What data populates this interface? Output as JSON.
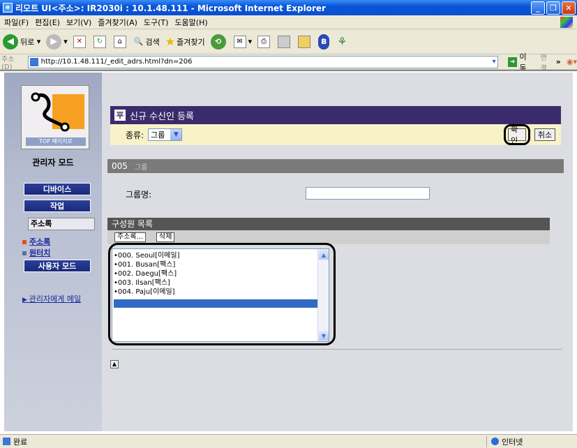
{
  "window": {
    "title": "리모트 UI<주소>: IR2030i : 10.1.48.111 - Microsoft Internet Explorer"
  },
  "menu": [
    "파일(F)",
    "편집(E)",
    "보기(V)",
    "즐겨찾기(A)",
    "도구(T)",
    "도움말(H)"
  ],
  "toolbar": {
    "back": "뒤로",
    "search": "검색",
    "favorites": "즐겨찾기"
  },
  "address": {
    "label": "주소(D)",
    "url": "http://10.1.48.111/_edit_adrs.html?dn=206",
    "go": "이동",
    "links": "연결"
  },
  "sidebar": {
    "top_label": "TOP 페이지로",
    "mode_title": "관리자 모드",
    "device": "디바이스",
    "job": "작업",
    "address_book": "주소록",
    "sub_address_book": "주소록",
    "sub_one_touch": "원터치",
    "user_mode": "사용자 모드",
    "mail_admin": "관리자에게 메일"
  },
  "form": {
    "title": "신규 수신인 등록",
    "type_label": "종류:",
    "type_value": "그룹",
    "ok": "확인",
    "cancel": "취소",
    "number": "005",
    "number_sub": "그룹",
    "group_name_label": "그룹명:",
    "group_name_value": "",
    "members_title": "구성원 목록",
    "tab_address_book": "주소록...",
    "tab_delete": "삭제",
    "members": [
      "•000. Seoul[이메일]",
      "•001. Busan[팩스]",
      "•002. Daegu[팩스]",
      "•003. Ilsan[팩스]",
      "•004. Paju[이메일]"
    ]
  },
  "status": {
    "done": "완료",
    "zone": "인터넷"
  }
}
